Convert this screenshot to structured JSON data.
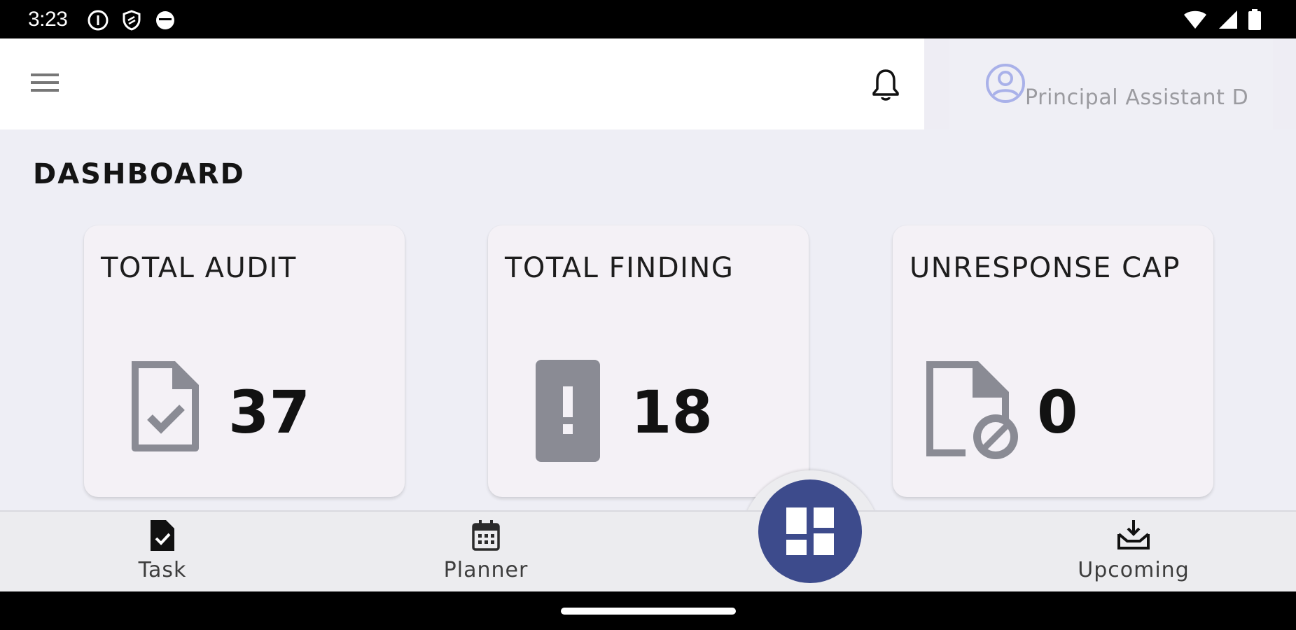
{
  "status_bar": {
    "time": "3:23",
    "left_icons": [
      "info-icon",
      "shield-icon",
      "mask-icon"
    ],
    "right_icons": [
      "wifi-icon",
      "cellular-icon",
      "battery-icon"
    ]
  },
  "app_bar": {
    "menu_icon": "hamburger-menu-icon",
    "notification_icon": "bell-icon",
    "profile_icon": "account-circle-icon",
    "profile_name": "Principal Assistant Director"
  },
  "page": {
    "title": "DASHBOARD"
  },
  "cards": [
    {
      "label": "TOTAL AUDIT",
      "icon": "document-check-icon",
      "count": "37"
    },
    {
      "label": "TOTAL FINDING",
      "icon": "phone-alert-icon",
      "count": "18"
    },
    {
      "label": "UNRESPONSE CAP",
      "icon": "document-blocked-icon",
      "count": "0"
    }
  ],
  "bottom_nav": {
    "items": [
      {
        "label": "Task",
        "icon": "task-document-icon"
      },
      {
        "label": "Planner",
        "icon": "calendar-icon"
      },
      {
        "label": "Upcoming",
        "icon": "inbox-arrow-icon"
      }
    ],
    "center_button_icon": "dashboard-grid-icon"
  },
  "colors": {
    "primary": "#3d4b8c",
    "background": "#eeeef5",
    "card": "#f4f1f6",
    "icon_gray": "#8a8b94"
  }
}
